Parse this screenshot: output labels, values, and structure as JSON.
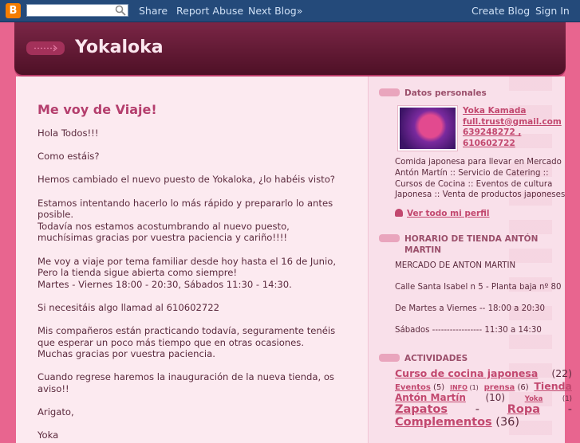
{
  "navbar": {
    "logo_letter": "B",
    "search_placeholder": "",
    "share": "Share",
    "report_abuse": "Report Abuse",
    "next_blog": "Next Blog»",
    "create_blog": "Create Blog",
    "sign_in": "Sign In"
  },
  "header": {
    "title": "Yokaloka"
  },
  "post": {
    "title": "Me voy de Viaje!",
    "paragraphs": [
      "Hola Todos!!!",
      "Como estáis?",
      "Hemos cambiado el nuevo puesto de Yokaloka, ¿lo habéis visto?",
      "Estamos intentando hacerlo lo más rápido y prepararlo lo antes\nposible.\nTodavía nos estamos acostumbrando al nuevo puesto,\nmuchísimas gracias por vuestra paciencia y cariño!!!!",
      "Me voy a viaje por tema familiar desde hoy hasta el 16 de Junio,\nPero la tienda sigue abierta como siempre!\nMartes - Viernes 18:00 - 20:30, Sábados 11:30 - 14:30.",
      "Si necesitáis algo llamad al 610602722",
      "Mis compañeros están practicando todavía, seguramente tenéis\nque esperar un poco más tiempo que en otras ocasiones.\nMuchas gracias por vuestra paciencia.",
      "Cuando regrese haremos la inauguración de la nueva tienda, os\naviso!!",
      "Arigato,",
      "Yoka"
    ]
  },
  "sidebar": {
    "profile": {
      "heading": "Datos personales",
      "name": "Yoka Kamada",
      "email": "full.trust@gmail.com",
      "phone1": "639248272 ,",
      "phone2": "610602722",
      "description": "Comida japonesa para llevar en Mercado Antón Martín :: Servicio de Catering :: Cursos de Cocina :: Eventos de cultura Japonesa :: Venta de productos japoneses",
      "full_profile": "Ver todo mi perfil"
    },
    "hours": {
      "heading": "HORARIO DE TIENDA ANTÓN MARTIN",
      "lines": [
        "MERCADO DE ANTON MARTIN",
        "Calle Santa Isabel n 5 - Planta baja nº 80",
        "De Martes a Viernes -- 18:00 a 20:30",
        "Sábados ----------------- 11:30 a 14:30"
      ]
    },
    "activities": {
      "heading": "ACTIVIDADES",
      "labels": [
        {
          "name": "Curso de cocina japonesa",
          "count": "(22)"
        },
        {
          "name": "Eventos",
          "count": "(5)"
        },
        {
          "name": "INFO",
          "count": "(1)"
        },
        {
          "name": "prensa",
          "count": "(6)"
        },
        {
          "name": "Tienda Antón Martín",
          "count": "(10)"
        },
        {
          "name": "Yoka",
          "count": "(1)"
        },
        {
          "name": "Zapatos - Ropa - Complementos",
          "count": "(36)"
        }
      ]
    }
  }
}
